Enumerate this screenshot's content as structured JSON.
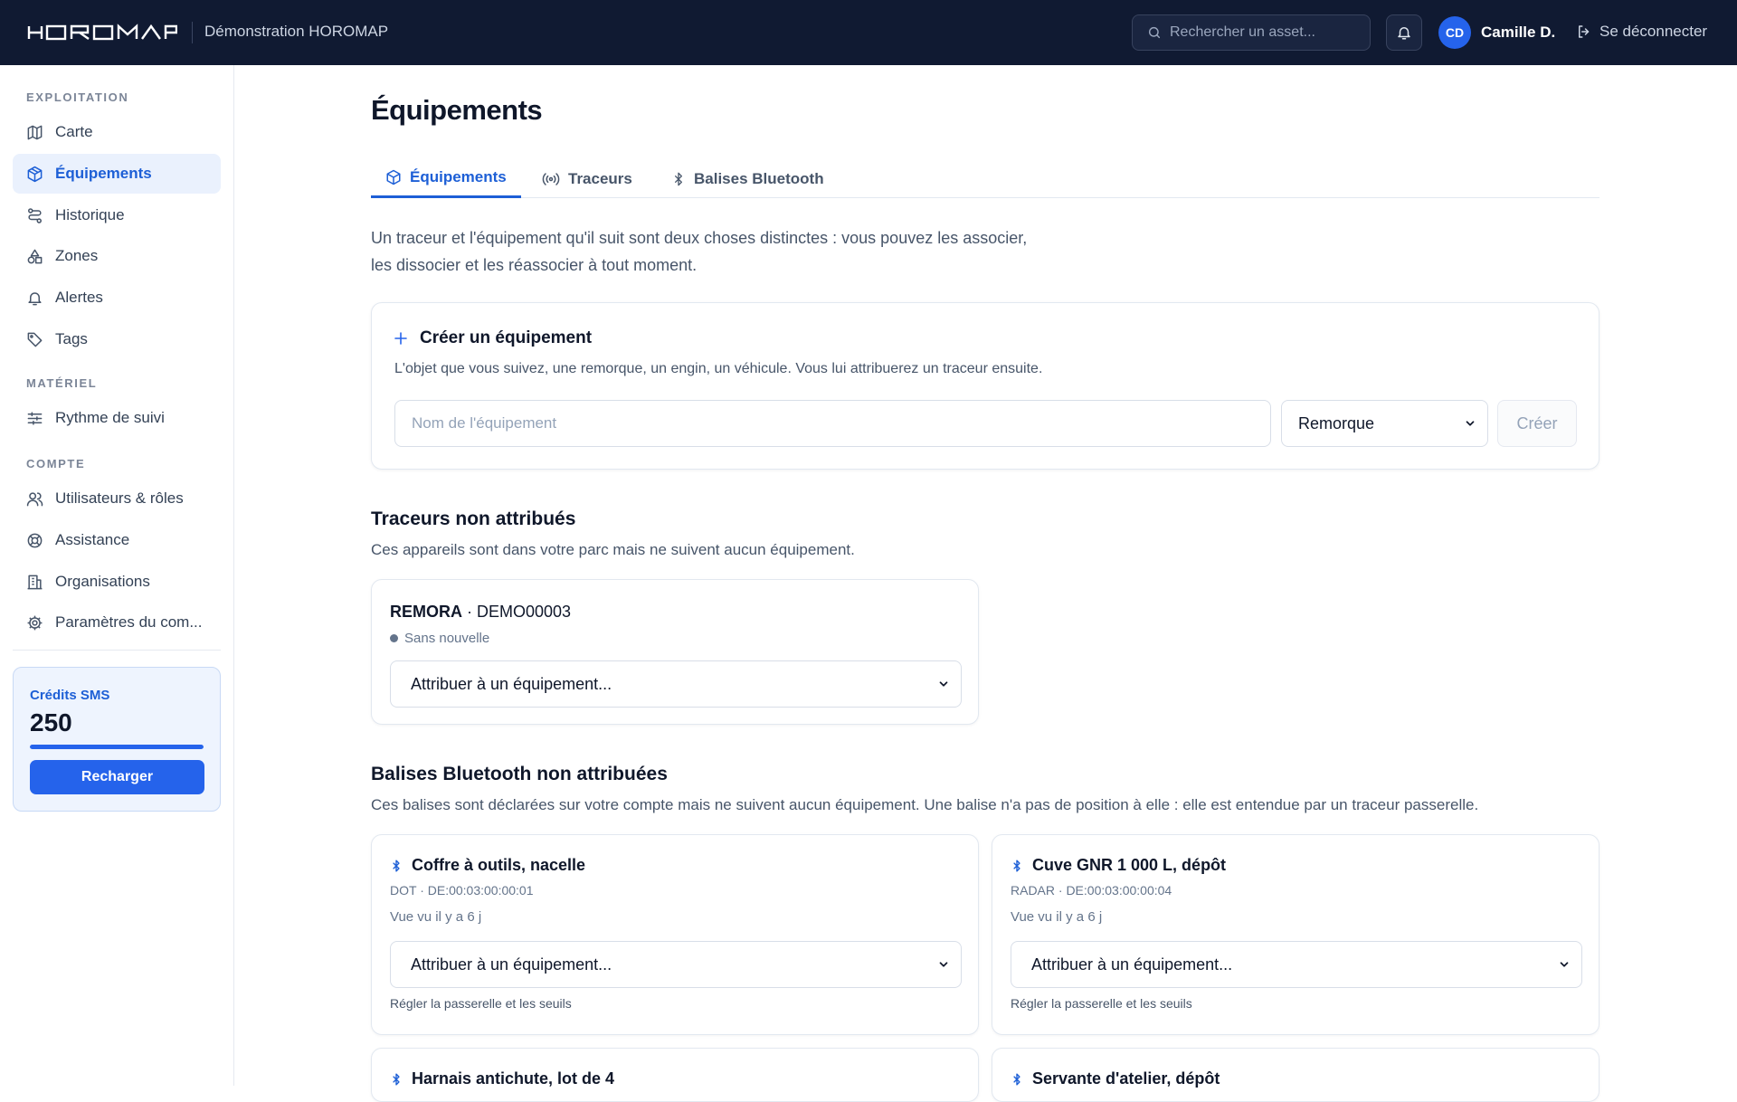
{
  "header": {
    "logo_text": "HOROMAP",
    "org_name": "Démonstration HOROMAP",
    "search_placeholder": "Rechercher un asset...",
    "user_initials": "CD",
    "user_name": "Camille D.",
    "logout_label": "Se déconnecter"
  },
  "sidebar": {
    "sections": [
      {
        "label": "EXPLOITATION"
      },
      {
        "label": "MATÉRIEL"
      },
      {
        "label": "COMPTE"
      }
    ],
    "items": [
      {
        "label": "Carte",
        "icon": "map-icon"
      },
      {
        "label": "Équipements",
        "icon": "box-icon",
        "active": true
      },
      {
        "label": "Historique",
        "icon": "route-icon"
      },
      {
        "label": "Zones",
        "icon": "shapes-icon"
      },
      {
        "label": "Alertes",
        "icon": "bell-icon"
      },
      {
        "label": "Tags",
        "icon": "tag-icon"
      },
      {
        "label": "Rythme de suivi",
        "icon": "sliders-icon"
      },
      {
        "label": "Utilisateurs & rôles",
        "icon": "users-icon"
      },
      {
        "label": "Assistance",
        "icon": "lifebuoy-icon"
      },
      {
        "label": "Organisations",
        "icon": "building-icon"
      },
      {
        "label": "Paramètres du com...",
        "icon": "gear-icon"
      }
    ],
    "sms": {
      "title": "Crédits SMS",
      "value": "250",
      "fill_fraction": 1.0,
      "button_label": "Recharger"
    }
  },
  "main": {
    "title": "Équipements",
    "tabs": [
      {
        "label": "Équipements",
        "icon": "box-icon",
        "active": true
      },
      {
        "label": "Traceurs",
        "icon": "broadcast-icon"
      },
      {
        "label": "Balises Bluetooth",
        "icon": "bluetooth-icon"
      }
    ],
    "intro_line1": "Un traceur et l'équipement qu'il suit sont deux choses distinctes : vous pouvez les associer,",
    "intro_line2": "les dissocier et les réassocier à tout moment.",
    "create": {
      "title": "Créer un équipement",
      "description": "L'objet que vous suivez, une remorque, un engin, un véhicule. Vous lui attribuerez un traceur ensuite.",
      "name_placeholder": "Nom de l'équipement",
      "type_value": "Remorque",
      "button_label": "Créer"
    },
    "unassigned_trackers": {
      "title": "Traceurs non attribués",
      "description": "Ces appareils sont dans votre parc mais ne suivent aucun équipement.",
      "items": [
        {
          "model": "REMORA",
          "serial": "DEMO00003",
          "status": "Sans nouvelle",
          "assign_placeholder": "Attribuer à un équipement..."
        }
      ]
    },
    "unassigned_beacons": {
      "title": "Balises Bluetooth non attribuées",
      "description": "Ces balises sont déclarées sur votre compte mais ne suivent aucun équipement. Une balise n'a pas de position à elle : elle est entendue par un traceur passerelle.",
      "items": [
        {
          "name": "Coffre à outils, nacelle",
          "meta": "DOT · DE:00:03:00:00:01",
          "seen": "Vue vu il y a 6 j",
          "assign_placeholder": "Attribuer à un équipement...",
          "link": "Régler la passerelle et les seuils"
        },
        {
          "name": "Cuve GNR 1 000 L, dépôt",
          "meta": "RADAR · DE:00:03:00:00:04",
          "seen": "Vue vu il y a 6 j",
          "assign_placeholder": "Attribuer à un équipement...",
          "link": "Régler la passerelle et les seuils"
        },
        {
          "name": "Harnais antichute, lot de 4"
        },
        {
          "name": "Servante d'atelier, dépôt"
        }
      ]
    }
  },
  "colors": {
    "header_bg": "#101a32",
    "accent": "#2563eb",
    "active_nav_bg": "#eaf1fd"
  }
}
